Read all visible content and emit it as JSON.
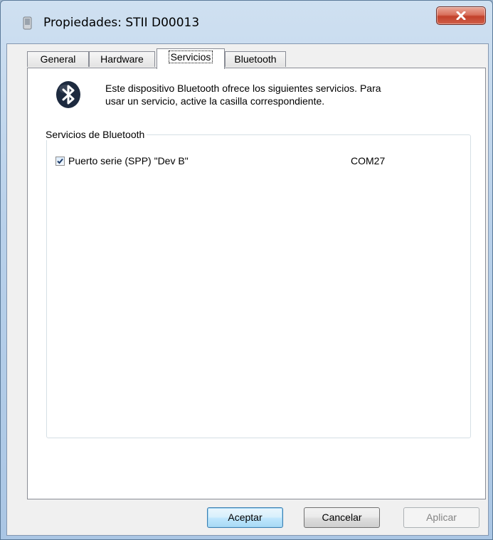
{
  "window": {
    "title": "Propiedades: STII D00013"
  },
  "tabs": [
    {
      "label": "General"
    },
    {
      "label": "Hardware"
    },
    {
      "label": "Servicios"
    },
    {
      "label": "Bluetooth"
    }
  ],
  "active_tab": "Servicios",
  "panel": {
    "intro_line1": "Este dispositivo Bluetooth ofrece los siguientes servicios. Para",
    "intro_line2": "usar un servicio, active la casilla correspondiente.",
    "group_title": "Servicios de Bluetooth",
    "services": [
      {
        "name": "Puerto serie (SPP) \"Dev B\"",
        "port": "COM27",
        "checked": true
      }
    ]
  },
  "buttons": {
    "ok": "Aceptar",
    "cancel": "Cancelar",
    "apply": "Aplicar"
  },
  "icons": {
    "app": "device-icon",
    "bluetooth": "bluetooth-icon",
    "close": "close-icon"
  },
  "colors": {
    "bluetooth_badge": "#1d2a3f",
    "close_button": "#c2402a",
    "default_button_border": "#3c7fb1"
  }
}
